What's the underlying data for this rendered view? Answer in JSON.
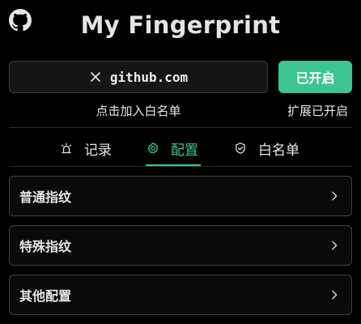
{
  "header": {
    "logo_icon": "github-icon",
    "title": "My Fingerprint"
  },
  "site": {
    "clear_icon": "close-icon",
    "domain": "github.com",
    "status_button": "已开启",
    "whitelist_hint": "点击加入白名单",
    "extension_status": "扩展已开启"
  },
  "tabs": [
    {
      "label": "记录",
      "icon": "alarm-icon",
      "active": false
    },
    {
      "label": "配置",
      "icon": "gear-icon",
      "active": true
    },
    {
      "label": "白名单",
      "icon": "shield-check-icon",
      "active": false
    }
  ],
  "settings": [
    {
      "label": "普通指纹",
      "icon": "chevron-right-icon"
    },
    {
      "label": "特殊指纹",
      "icon": "chevron-right-icon"
    },
    {
      "label": "其他配置",
      "icon": "chevron-right-icon"
    }
  ],
  "colors": {
    "accent": "#3cc591",
    "background": "#000000",
    "border": "#444444"
  }
}
